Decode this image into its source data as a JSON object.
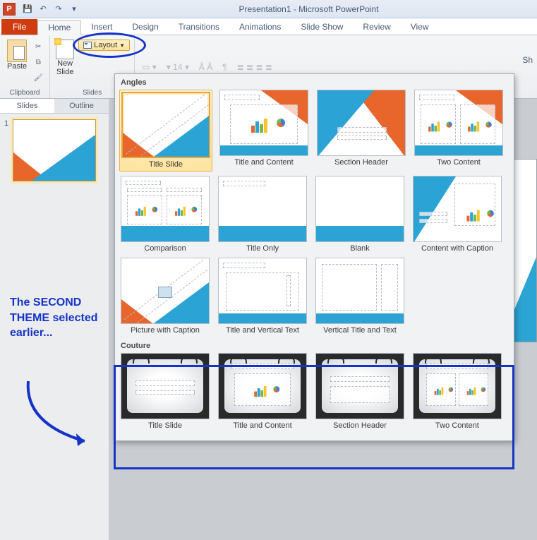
{
  "titlebar": {
    "title": "Presentation1 - Microsoft PowerPoint",
    "app_letter": "P"
  },
  "tabs": {
    "file": "File",
    "home": "Home",
    "insert": "Insert",
    "design": "Design",
    "transitions": "Transitions",
    "animations": "Animations",
    "slideshow": "Slide Show",
    "review": "Review",
    "view": "View"
  },
  "ribbon": {
    "paste": "Paste",
    "clipboard": "Clipboard",
    "newslide": "New\nSlide",
    "slides": "Slides",
    "layout": "Layout",
    "fontsize": "14",
    "sh": "Sh"
  },
  "leftrail": {
    "slides": "Slides",
    "outline": "Outline",
    "num1": "1"
  },
  "gallery": {
    "section1": "Angles",
    "section2": "Couture",
    "items1": [
      "Title Slide",
      "Title and Content",
      "Section Header",
      "Two Content",
      "Comparison",
      "Title Only",
      "Blank",
      "Content with Caption",
      "Picture with Caption",
      "Title and Vertical Text",
      "Vertical Title and Text"
    ],
    "items2": [
      "Title Slide",
      "Title and Content",
      "Section Header",
      "Two Content"
    ]
  },
  "annotation": {
    "text": "The SECOND THEME selected earlier..."
  }
}
